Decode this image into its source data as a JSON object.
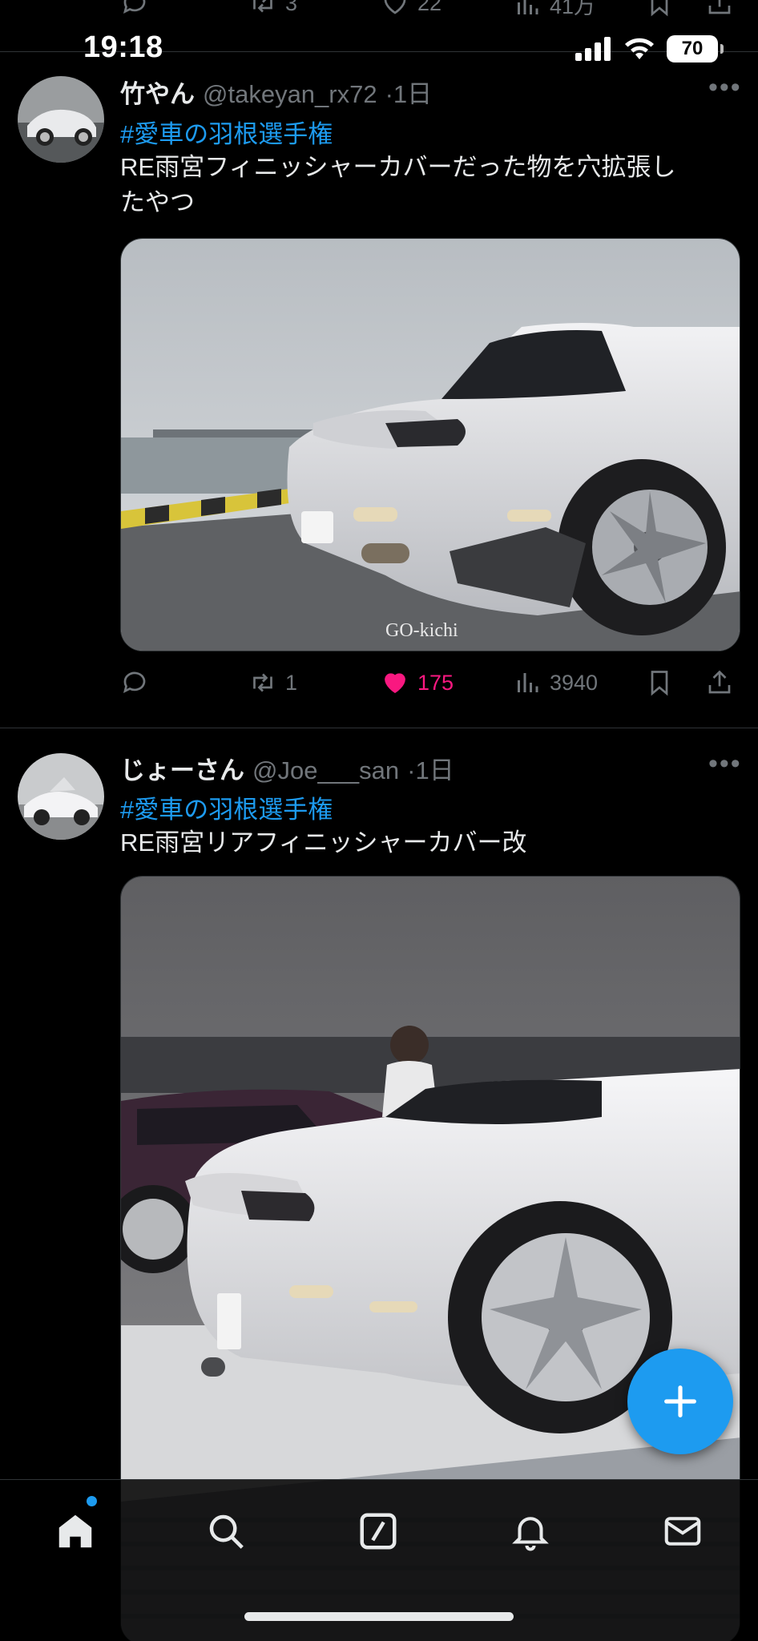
{
  "status_bar": {
    "time": "19:18",
    "battery": "70"
  },
  "previous_tweet_actions": {
    "retweets": "3",
    "likes": "22",
    "views": "41万"
  },
  "tweets": [
    {
      "name": "竹やん",
      "handle": "@takeyan_rx72",
      "time": "·1日",
      "hashtag": "#愛車の羽根選手権",
      "text_line1": "RE雨宮フィニッシャーカバーだった物を穴拡張し",
      "text_line2": "たやつ",
      "image_caption": "GO-kichi",
      "replies": "",
      "retweets": "1",
      "likes": "175",
      "views": "3940"
    },
    {
      "name": "じょーさん",
      "handle": "@Joe___san",
      "time": "·1日",
      "hashtag": "#愛車の羽根選手権",
      "text_line1": "RE雨宮リアフィニッシャーカバー改"
    }
  ],
  "colors": {
    "accent": "#1d9bf0",
    "like": "#f91880",
    "muted": "#71767b",
    "text": "#e7e9ea",
    "background": "#000000"
  },
  "icons": [
    "reply-icon",
    "retweet-icon",
    "like-icon",
    "views-icon",
    "bookmark-icon",
    "share-icon",
    "more-icon",
    "home-icon",
    "search-icon",
    "grok-icon",
    "notifications-icon",
    "messages-icon",
    "compose-plus-icon"
  ]
}
